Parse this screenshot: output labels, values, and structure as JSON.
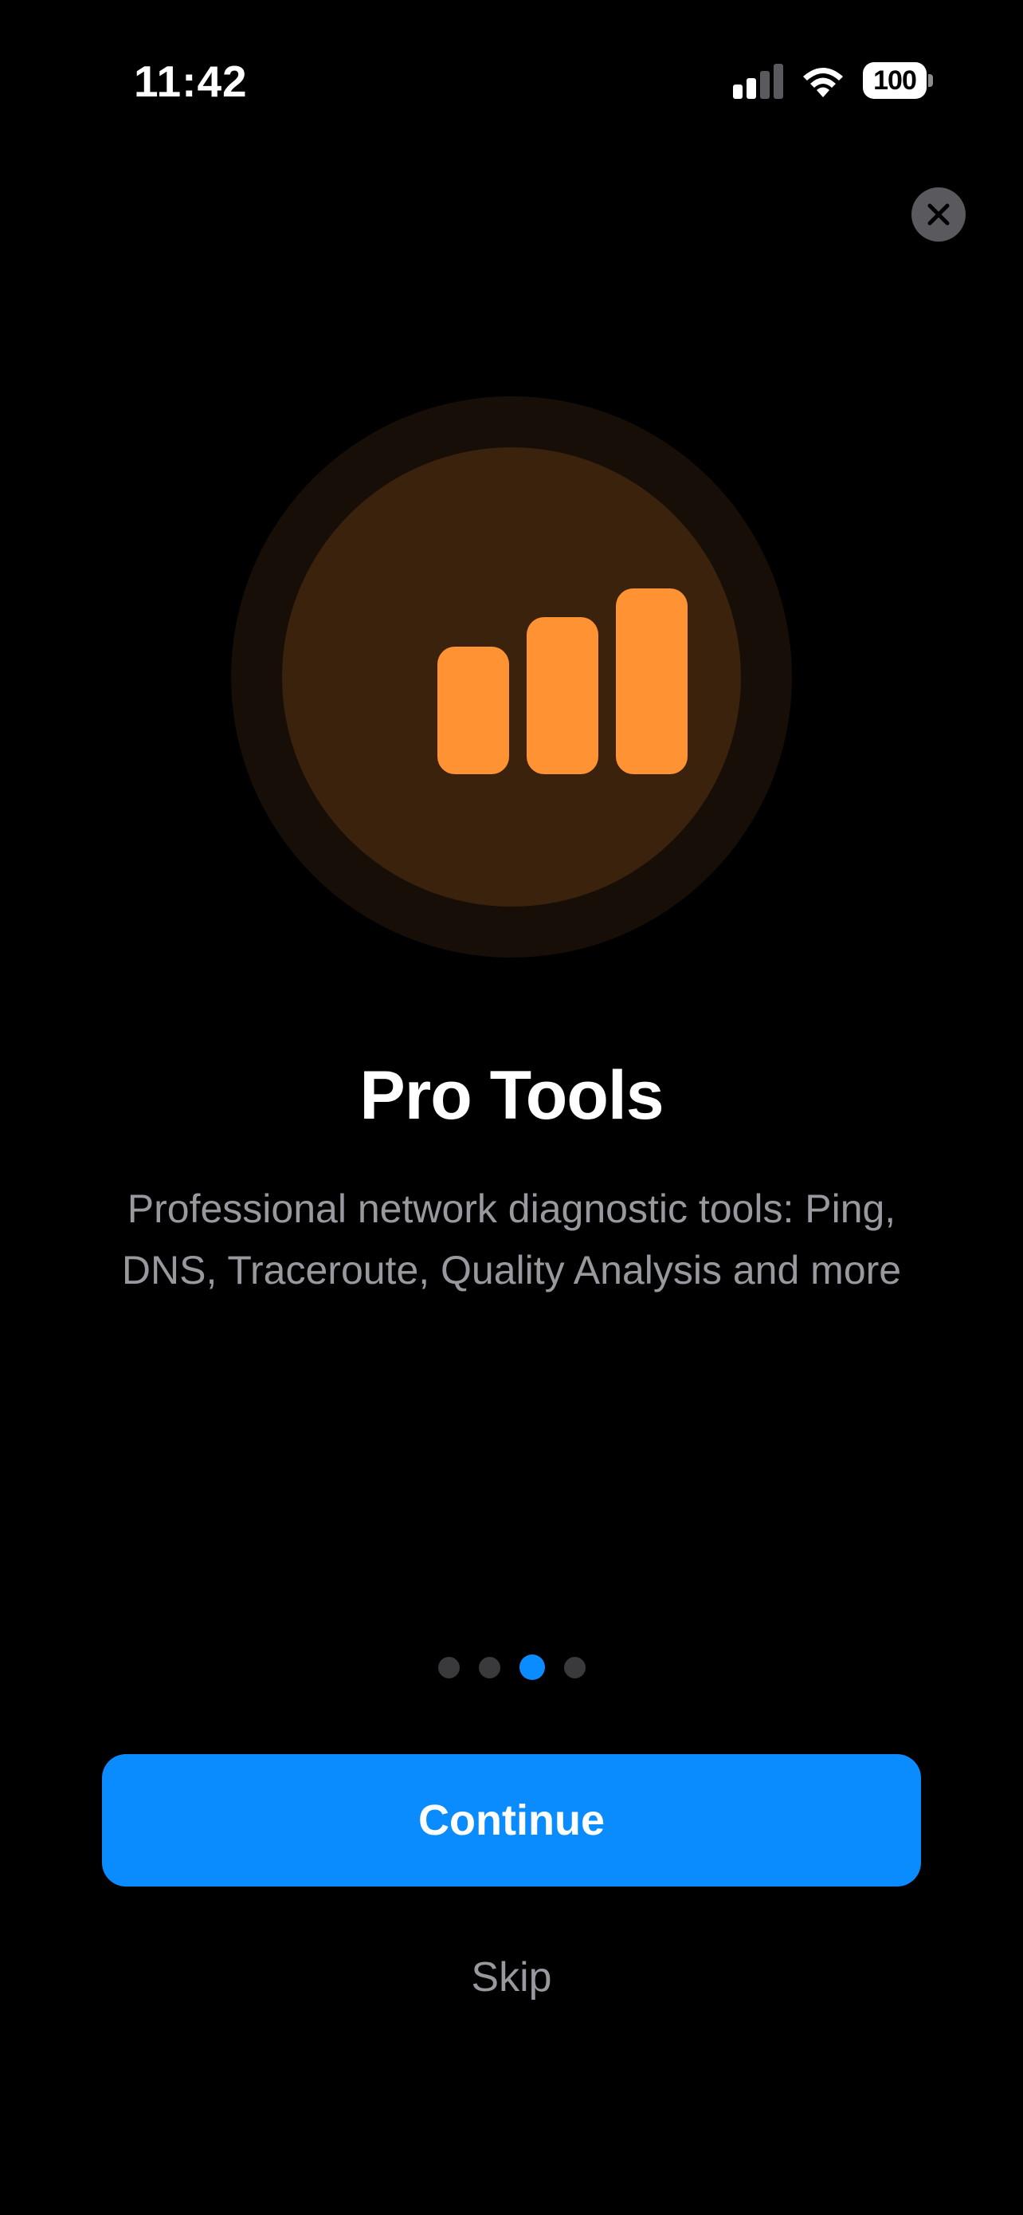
{
  "status_bar": {
    "time": "11:42",
    "battery_level": "100",
    "signal_bars_active": 2,
    "signal_bars_total": 4
  },
  "colors": {
    "accent": "#0a8cff",
    "icon_orange": "#ff9233",
    "dot_inactive": "#3a3a3c",
    "dot_active": "#0a8cff",
    "signal_inactive": "#5a5a5e"
  },
  "close_button": {
    "icon": "close-icon"
  },
  "hero": {
    "icon": "chart-bars-icon"
  },
  "content": {
    "title": "Pro Tools",
    "description": "Professional network diagnostic tools: Ping, DNS, Traceroute, Quality Analysis and more"
  },
  "pagination": {
    "total": 4,
    "active_index": 2
  },
  "actions": {
    "continue_label": "Continue",
    "skip_label": "Skip"
  }
}
